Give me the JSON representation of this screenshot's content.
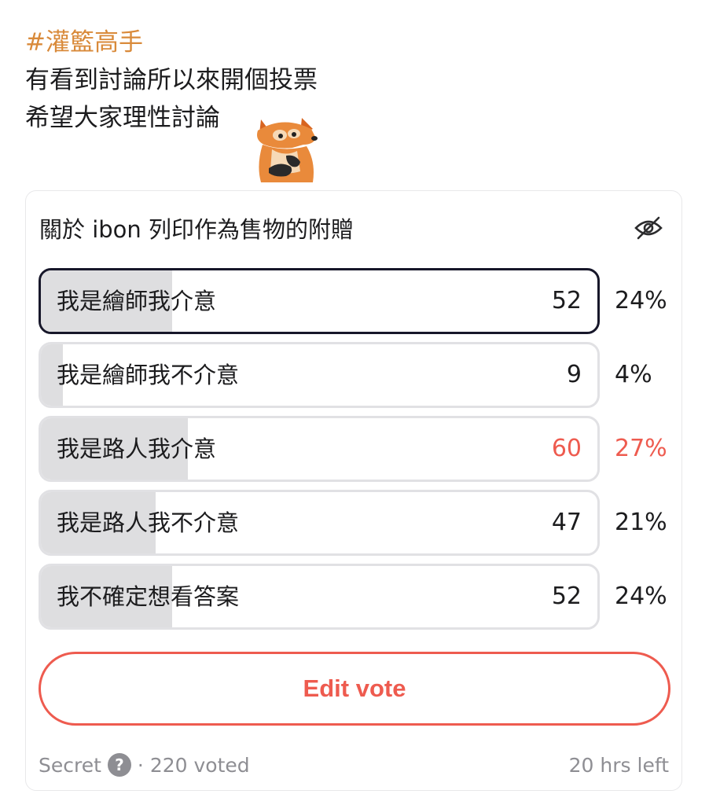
{
  "post": {
    "hashtag": "#灌籃高手",
    "line1": "有看到討論所以來開個投票",
    "line2": "希望大家理性討論"
  },
  "sticker": {
    "icon": "fox-thinking-sticker-icon"
  },
  "poll": {
    "title": "關於 ibon 列印作為售物的附贈",
    "hide_icon": "eye-slash-icon",
    "options": [
      {
        "label": "我是繪師我介意",
        "count": "52",
        "percent": "24%",
        "fill": 0.24,
        "selected": true,
        "winner": false
      },
      {
        "label": "我是繪師我不介意",
        "count": "9",
        "percent": "4%",
        "fill": 0.04,
        "selected": false,
        "winner": false
      },
      {
        "label": "我是路人我介意",
        "count": "60",
        "percent": "27%",
        "fill": 0.27,
        "selected": false,
        "winner": true
      },
      {
        "label": "我是路人我不介意",
        "count": "47",
        "percent": "21%",
        "fill": 0.21,
        "selected": false,
        "winner": false
      },
      {
        "label": "我不確定想看答案",
        "count": "52",
        "percent": "24%",
        "fill": 0.24,
        "selected": false,
        "winner": false
      }
    ],
    "edit_button": "Edit vote",
    "footer": {
      "privacy": "Secret",
      "help_icon": "question-icon",
      "voted": "· 220 voted",
      "time_left": "20 hrs left"
    }
  },
  "colors": {
    "accent": "#ee5b4f",
    "hashtag": "#d98a3a",
    "fill": "#dedee0",
    "selected_border": "#17172a"
  }
}
